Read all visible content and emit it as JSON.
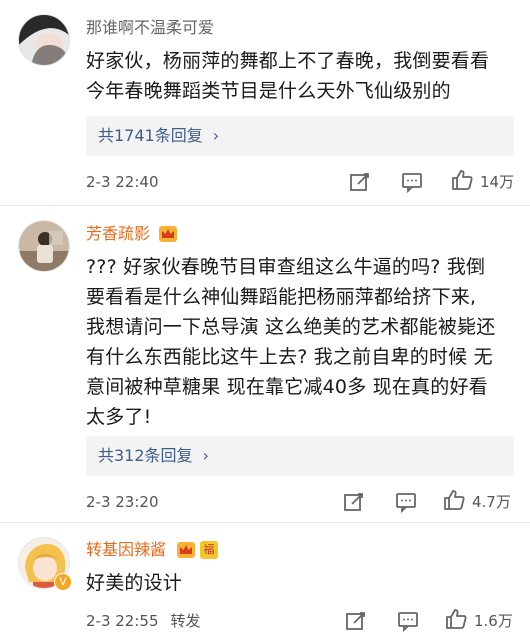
{
  "comments": [
    {
      "username": "那谁啊不温柔可爱",
      "text_lines": [
        "好家伙，杨丽萍的舞都上不了春晚，我倒要看看",
        "今年春晚舞蹈类节目是什么天外飞仙级别的"
      ],
      "replies_label": "共1741条回复",
      "time": "2-3 22:40",
      "likes": "14万",
      "avatar_icon": "dark-hair-woman-avatar"
    },
    {
      "username": "芳香疏影",
      "text_lines": [
        "??? 好家伙春晚节目审查组这么牛逼的吗? 我倒",
        "要看看是什么神仙舞蹈能把杨丽萍都给挤下来,",
        "我想请问一下总导演 这么绝美的艺术都能被毙还",
        "有什么东西能比这牛上去? 我之前自卑的时候 无",
        "意间被种草糖果 现在靠它减40多 现在真的好看",
        "太多了!"
      ],
      "replies_label": "共312条回复",
      "time": "2-3 23:20",
      "likes": "4.7万",
      "avatar_icon": "woman-sitting-avatar",
      "badge_icon": "vip-crown-icon"
    },
    {
      "username": "转基因辣酱",
      "text_lines": [
        "好美的设计"
      ],
      "time": "2-3 22:55",
      "forward_label": "转发",
      "likes": "1.6万",
      "avatar_icon": "anime-girl-avatar",
      "badge_icon": "vip-crown-icon",
      "extra_badge": "福",
      "verified_badge": "V"
    }
  ],
  "colors": {
    "vip_name": "#e86b1c",
    "reply_link": "#3f5d8a",
    "reply_bg": "#f3f3f3",
    "meta_text": "#555555"
  }
}
